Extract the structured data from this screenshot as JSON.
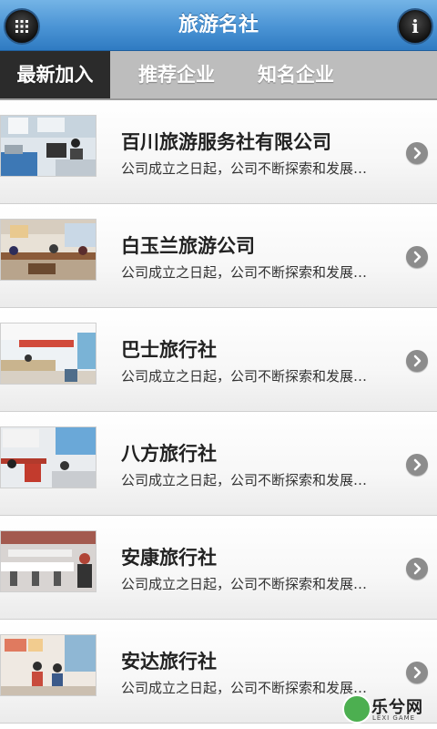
{
  "header": {
    "title": "旅游名社",
    "menu_icon": "grid-icon",
    "info_icon": "info-icon",
    "info_glyph": "i"
  },
  "tabs": [
    {
      "label": "最新加入",
      "active": true
    },
    {
      "label": "推荐企业",
      "active": false
    },
    {
      "label": "知名企业",
      "active": false
    }
  ],
  "list": {
    "items": [
      {
        "title": "百川旅游服务社有限公司",
        "desc": "公司成立之日起，公司不断探索和发展…"
      },
      {
        "title": "白玉兰旅游公司",
        "desc": "公司成立之日起，公司不断探索和发展…"
      },
      {
        "title": "巴士旅行社",
        "desc": "公司成立之日起，公司不断探索和发展…"
      },
      {
        "title": "八方旅行社",
        "desc": "公司成立之日起，公司不断探索和发展…"
      },
      {
        "title": "安康旅行社",
        "desc": "公司成立之日起，公司不断探索和发展…"
      },
      {
        "title": "安达旅行社",
        "desc": "公司成立之日起，公司不断探索和发展…"
      }
    ]
  },
  "watermark": {
    "text": "乐兮网",
    "sub": "LEXI GAME"
  },
  "colors": {
    "header": "#4a93d4",
    "tab_bar": "#bdbdbd",
    "tab_active": "#2b2b2b"
  }
}
